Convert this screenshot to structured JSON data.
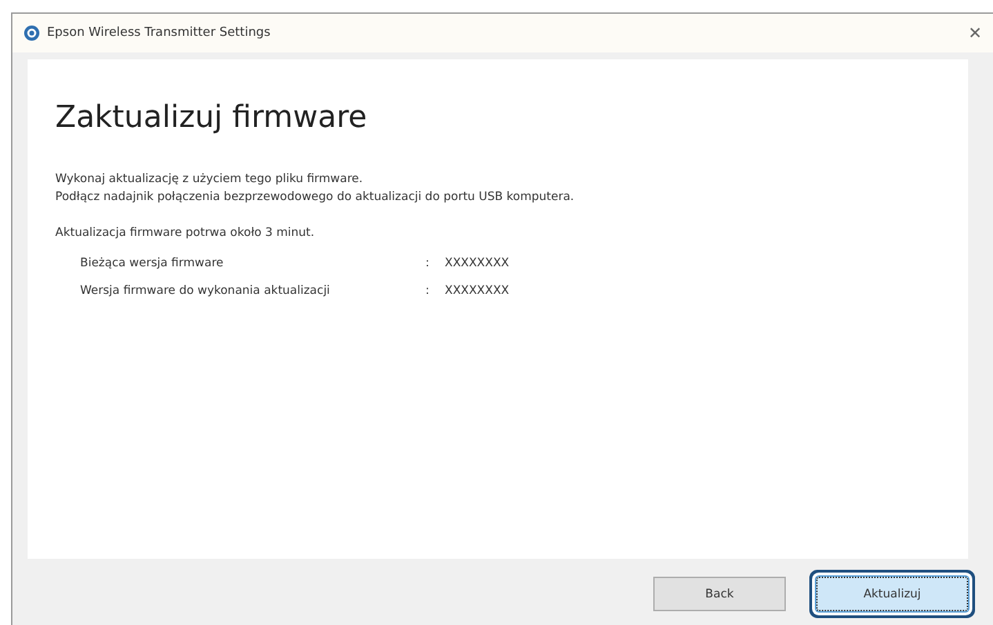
{
  "window": {
    "title": "Epson Wireless Transmitter Settings",
    "close": "✕"
  },
  "heading": "Zaktualizuj firmware",
  "intro": [
    "Wykonaj aktualizację z użyciem tego pliku firmware.",
    "Podłącz nadajnik połączenia bezprzewodowego do aktualizacji do portu USB komputera."
  ],
  "note": "Aktualizacja firmware potrwa około 3 minut.",
  "details": [
    {
      "label": "Bieżąca wersja firmware",
      "separator": ":",
      "value": "XXXXXXXX"
    },
    {
      "label": "Wersja firmware do wykonania aktualizacji",
      "separator": ":",
      "value": "XXXXXXXX"
    }
  ],
  "buttons": [
    {
      "label": "Back",
      "selected": false
    },
    {
      "label": "Aktualizuj",
      "selected": true
    }
  ]
}
